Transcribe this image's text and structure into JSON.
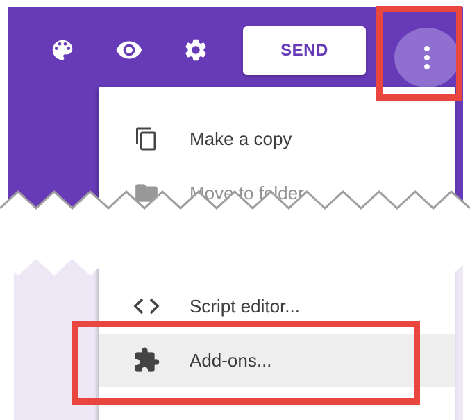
{
  "toolbar": {
    "palette_icon": "palette-icon",
    "preview_icon": "eye-icon",
    "settings_icon": "gear-icon",
    "send_label": "SEND",
    "more_icon": "more-vert-icon"
  },
  "menu_top": {
    "items": [
      {
        "label": "Make a copy",
        "icon": "copy-icon"
      },
      {
        "label": "Move to folder",
        "icon": "folder-icon"
      }
    ]
  },
  "menu_bottom": {
    "items": [
      {
        "label": "Script editor...",
        "icon": "code-icon"
      },
      {
        "label": "Add-ons...",
        "icon": "puzzle-icon"
      }
    ]
  },
  "colors": {
    "brand": "#673ab7",
    "highlight": "#e8463e",
    "menu_text": "#3c3c3c"
  }
}
